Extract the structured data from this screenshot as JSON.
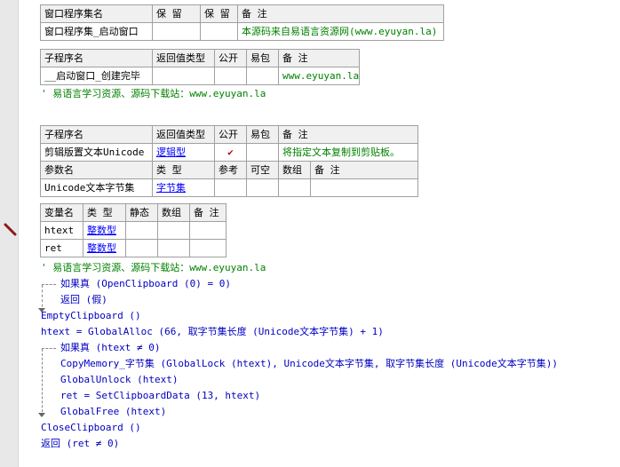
{
  "table1": {
    "headers": [
      "窗口程序集名",
      "保 留",
      "保 留",
      "备 注"
    ],
    "row": [
      "窗口程序集_启动窗口",
      "",
      "",
      "本源码来自易语言资源网(www.eyuyan.la)"
    ]
  },
  "table2": {
    "headers": [
      "子程序名",
      "返回值类型",
      "公开",
      "易包",
      "备 注"
    ],
    "row": [
      "__启动窗口_创建完毕",
      "",
      "",
      "",
      "www.eyuyan.la"
    ]
  },
  "comment1": "' 易语言学习资源、源码下载站：www.eyuyan.la",
  "table3": {
    "headers": [
      "子程序名",
      "返回值类型",
      "公开",
      "易包",
      "备 注"
    ],
    "row": [
      "剪辑版置文本Unicode",
      "逻辑型",
      "✔",
      "",
      "将指定文本复制到剪贴板。"
    ],
    "param_headers": [
      "参数名",
      "类 型",
      "参考",
      "可空",
      "数组",
      "备 注"
    ],
    "param_row": [
      "Unicode文本字节集",
      "字节集",
      "",
      "",
      "",
      ""
    ]
  },
  "table4": {
    "headers": [
      "变量名",
      "类 型",
      "静态",
      "数组",
      "备 注"
    ],
    "rows": [
      [
        "htext",
        "整数型",
        "",
        "",
        ""
      ],
      [
        "ret",
        "整数型",
        "",
        "",
        ""
      ]
    ]
  },
  "comment2": "' 易语言学习资源、源码下载站：www.eyuyan.la",
  "code": [
    "如果真 (OpenClipboard (0) = 0)",
    "返回 (假)",
    "EmptyClipboard ()",
    "htext = GlobalAlloc (66, 取字节集长度 (Unicode文本字节集) + 1)",
    "如果真 (htext ≠ 0)",
    "CopyMemory_字节集 (GlobalLock (htext), Unicode文本字节集, 取字节集长度 (Unicode文本字节集))",
    "GlobalUnlock (htext)",
    "ret = SetClipboardData (13, htext)",
    "GlobalFree (htext)",
    "CloseClipboard ()",
    "返回 (ret ≠ 0)"
  ],
  "icons": {
    "breakpoint": "pencil-icon",
    "check": "checkmark-icon"
  }
}
